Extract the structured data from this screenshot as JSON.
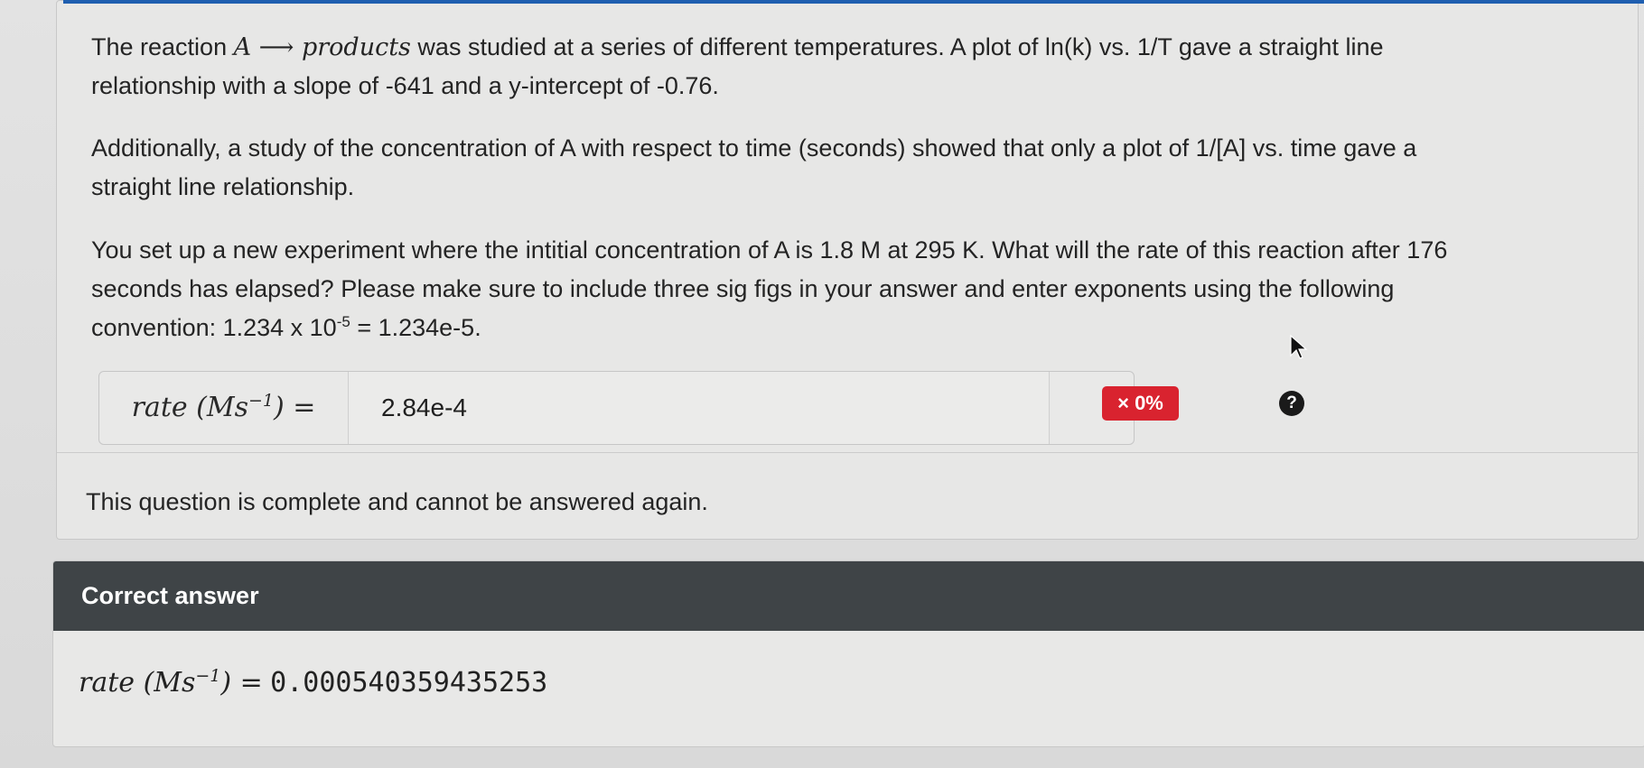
{
  "question": {
    "p1_before_math": "The reaction ",
    "p1_math": "A ⟶ products",
    "p1_after_math_line1": " was studied at a series of different temperatures. A plot of ln(k) vs. 1/T gave a straight line",
    "p1_line2": "relationship with a slope of -641 and a y-intercept of -0.76.",
    "p2_line1": "Additionally, a study of the concentration of A with respect to time (seconds) showed that only a plot of 1/[A] vs. time gave a",
    "p2_line2": "straight line relationship.",
    "p3_line1": "You set up a new experiment where the intitial concentration of A is 1.8 M at 295 K. What will the rate of this reaction after 176",
    "p3_line2": "seconds has elapsed? Please make sure to include three sig figs in your answer and enter exponents using the following",
    "p3_line3_a": "convention: 1.234 x 10",
    "p3_line3_sup": "-5",
    "p3_line3_b": " = 1.234e-5."
  },
  "answer": {
    "label_a": "rate (Ms",
    "label_sup": "−1",
    "label_b": ") =",
    "value": "2.84e-4",
    "help_glyph": "?",
    "help_icon": "question-circle-icon",
    "score": "× 0%",
    "score_color": "#d9232f"
  },
  "status": {
    "complete_message": "This question is complete and cannot be answered again."
  },
  "correct": {
    "title": "Correct answer",
    "label_a": "rate (Ms",
    "label_sup": "−1",
    "label_b": ") =",
    "value": "0.000540359435253",
    "header_color": "#3f4447"
  },
  "accent_color": "#1f5fb0"
}
